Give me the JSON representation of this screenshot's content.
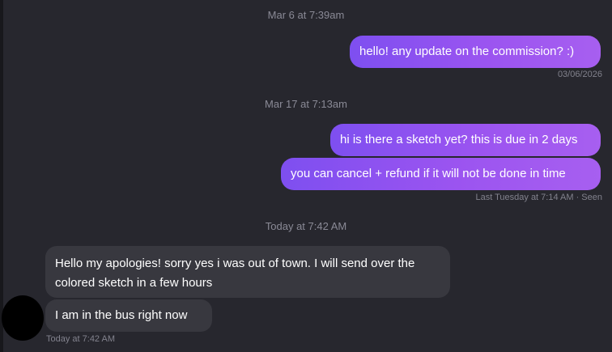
{
  "conversation": {
    "messages_group1": {
      "timestamp": "Mar 6 at 7:39am",
      "out_message": "hello! any update on the commission? :)",
      "meta": "03/06/2026"
    },
    "messages_group2": {
      "timestamp": "Mar 17 at 7:13am",
      "out_message_1": "hi is there a sketch yet? this is due in 2 days",
      "out_message_2": "you can cancel + refund if it will not be done in time",
      "meta": "Last Tuesday at 7:14 AM · Seen"
    },
    "messages_group3": {
      "timestamp": "Today at 7:42 AM",
      "in_message_1": "Hello my apologies! sorry yes i was out of town. I will send over the colored sketch in a few hours",
      "in_message_2": "I am in the bus right now",
      "meta": "Today at 7:42 AM"
    }
  },
  "colors": {
    "background": "#27272e",
    "outgoing_bubble_start": "#7e4ff0",
    "outgoing_bubble_end": "#a75ff0",
    "incoming_bubble": "#38383f",
    "avatar": "#000000"
  }
}
